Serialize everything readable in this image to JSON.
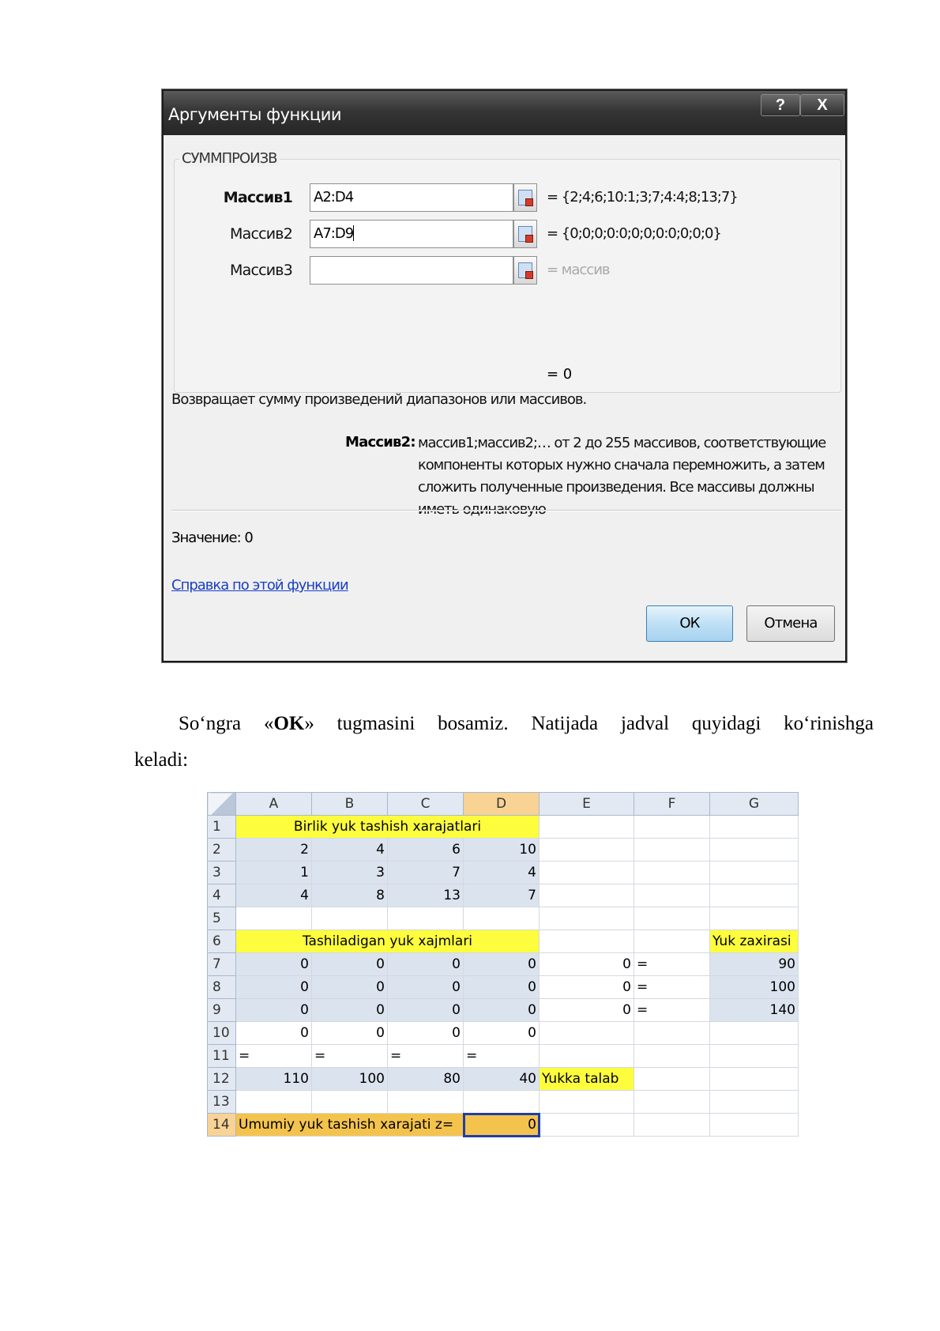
{
  "dialog": {
    "title": "Аргументы функции",
    "help_button": "?",
    "close_button": "X",
    "function_name": "СУММПРОИЗВ",
    "args": [
      {
        "label": "Массив1",
        "value": "A2:D4",
        "result": "=  {2;4;6;10:1;3;7;4:4;8;13;7}"
      },
      {
        "label": "Массив2",
        "value": "A7:D9",
        "result": "=  {0;0;0;0:0;0;0;0:0;0;0;0}"
      },
      {
        "label": "Массив3",
        "value": "",
        "result": "=  массив"
      }
    ],
    "total_result": "=  0",
    "description": "Возвращает сумму произведений диапазонов или массивов.",
    "param_name": "Массив2:",
    "param_description": "массив1;массив2;… от 2 до 255 массивов, соответствующие компоненты которых нужно сначала перемножить, а затем сложить полученные произведения. Все массивы должны иметь одинаковую",
    "value_line": "Значение:  0",
    "help_link": "Справка по этой функции",
    "ok": "ОК",
    "cancel": "Отмена"
  },
  "paragraph": {
    "line1_pre": "So‘ngra «",
    "line1_bold": "OK",
    "line1_post": "» tugmasini bosamiz. Natijada jadval quyidagi ko‘rinishga",
    "line2": "keladi:"
  },
  "sheet": {
    "columns": [
      "A",
      "B",
      "C",
      "D",
      "E",
      "F",
      "G"
    ],
    "rows": [
      "1",
      "2",
      "3",
      "4",
      "5",
      "6",
      "7",
      "8",
      "9",
      "10",
      "11",
      "12",
      "13",
      "14"
    ],
    "title1": "Birlik yuk tashish xarajatlari",
    "costs": [
      [
        "2",
        "4",
        "6",
        "10"
      ],
      [
        "1",
        "3",
        "7",
        "4"
      ],
      [
        "4",
        "8",
        "13",
        "7"
      ]
    ],
    "title2": "Tashiladigan yuk xajmlari",
    "stock_label": "Yuk zaxirasi",
    "volumes": [
      [
        "0",
        "0",
        "0",
        "0"
      ],
      [
        "0",
        "0",
        "0",
        "0"
      ],
      [
        "0",
        "0",
        "0",
        "0"
      ]
    ],
    "row_sums": [
      "0",
      "0",
      "0"
    ],
    "eq": "=",
    "stock": [
      "90",
      "100",
      "140"
    ],
    "col_sums": [
      "0",
      "0",
      "0",
      "0"
    ],
    "demand": [
      "110",
      "100",
      "80",
      "40"
    ],
    "demand_label": "Yukka talab",
    "total_label": "Umumiy yuk tashish xarajati z=",
    "total_value": "0"
  }
}
